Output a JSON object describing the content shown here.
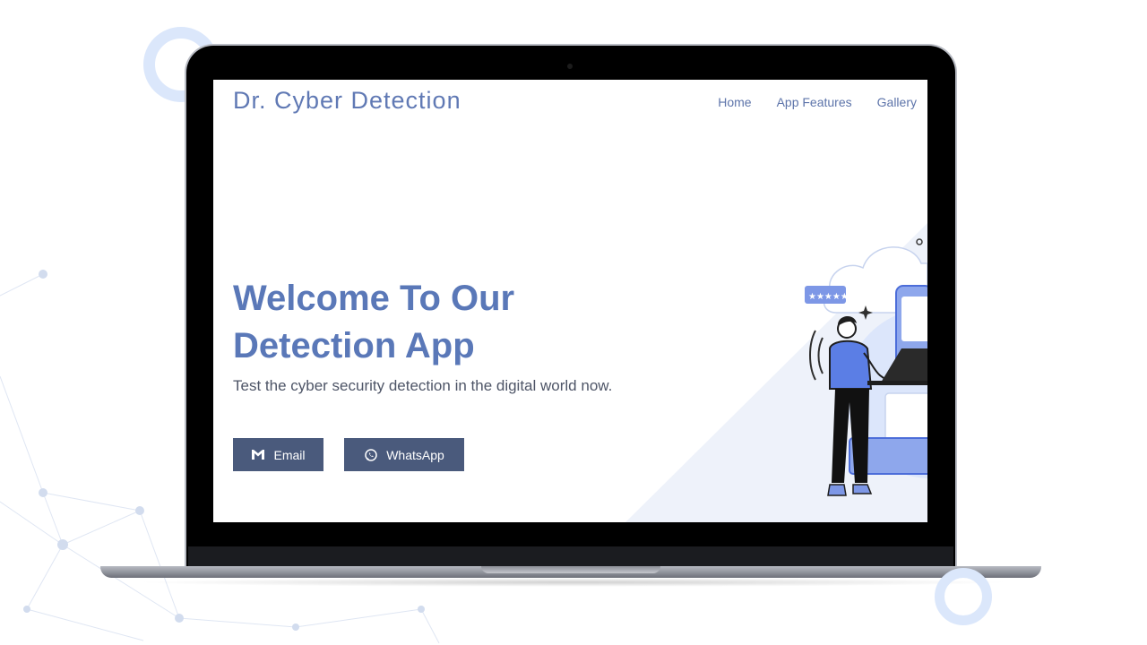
{
  "site": {
    "brand": "Dr. Cyber Detection"
  },
  "nav": {
    "items": [
      {
        "label": "Home"
      },
      {
        "label": "App Features"
      },
      {
        "label": "Gallery"
      }
    ]
  },
  "hero": {
    "title_line1": "Welcome To Our",
    "title_line2": "Detection App",
    "subtitle": "Test the cyber security detection in the digital world now.",
    "buttons": {
      "email": {
        "label": "Email",
        "icon": "gmail-icon"
      },
      "whatsapp": {
        "label": "WhatsApp",
        "icon": "whatsapp-icon"
      }
    }
  },
  "illustration": {
    "rating_badge": "★★★★★"
  },
  "colors": {
    "brand": "#6079b4",
    "button_bg": "#4a5a7c",
    "accent_light": "#dbe7fb",
    "illustration_blue": "#5b7ee5"
  }
}
